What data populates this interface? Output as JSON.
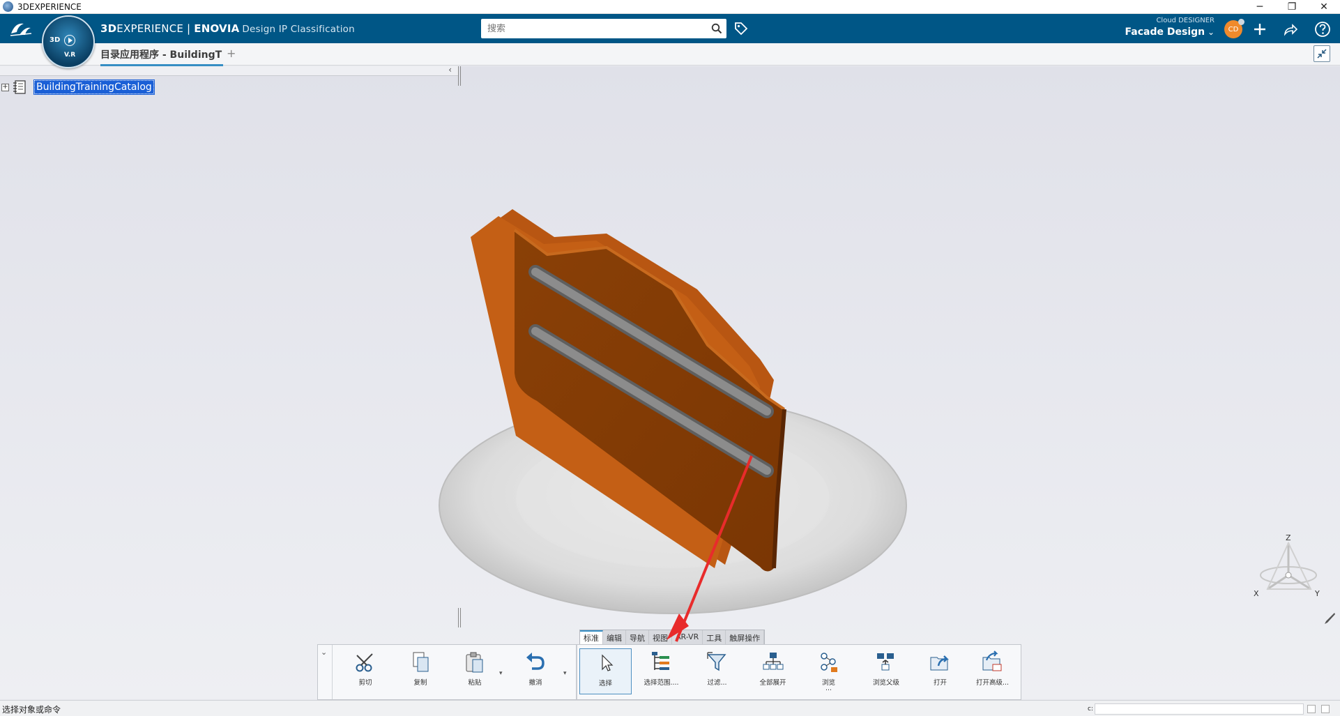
{
  "window": {
    "title": "3DEXPERIENCE",
    "minimize": "─",
    "restore": "❐",
    "close": "✕"
  },
  "header": {
    "brand_bold": "3D",
    "brand_rest": "EXPERIENCE | ",
    "brand_app": "ENOVIA",
    "brand_sub": "Design IP Classification",
    "compass_3d": "3D",
    "compass_vr": "V.R",
    "search_placeholder": "搜索",
    "role_label": "Cloud DESIGNER",
    "role_name": "Facade Design",
    "avatar_initials": "CD",
    "accent_color": "#005686"
  },
  "tabs": {
    "active_label": "目录应用程序 - BuildingT",
    "add_label": "+"
  },
  "tree": {
    "collapse_glyph": "‹",
    "expander_glyph": "+",
    "root_label": "BuildingTrainingCatalog"
  },
  "toolbar": {
    "tabs": [
      "标准",
      "编辑",
      "导航",
      "视图",
      "AR-VR",
      "工具",
      "触屏操作"
    ],
    "buttons": {
      "cut": "剪切",
      "copy": "复制",
      "paste": "粘贴",
      "undo": "撤消",
      "select": "选择",
      "select_scope": "选择范围....",
      "filter": "过滤...",
      "expand_all": "全部展开",
      "browse": "浏览",
      "browse_more": "...",
      "browse_parent": "浏览父级",
      "open": "打开",
      "open_advanced": "打开高级..."
    },
    "collapse_glyph": "⌄",
    "dropdown_glyph": "▾"
  },
  "axes": {
    "x": "X",
    "y": "Y",
    "z": "Z"
  },
  "statusbar": {
    "message": "选择对象或命令",
    "cmd_label": "c:"
  }
}
